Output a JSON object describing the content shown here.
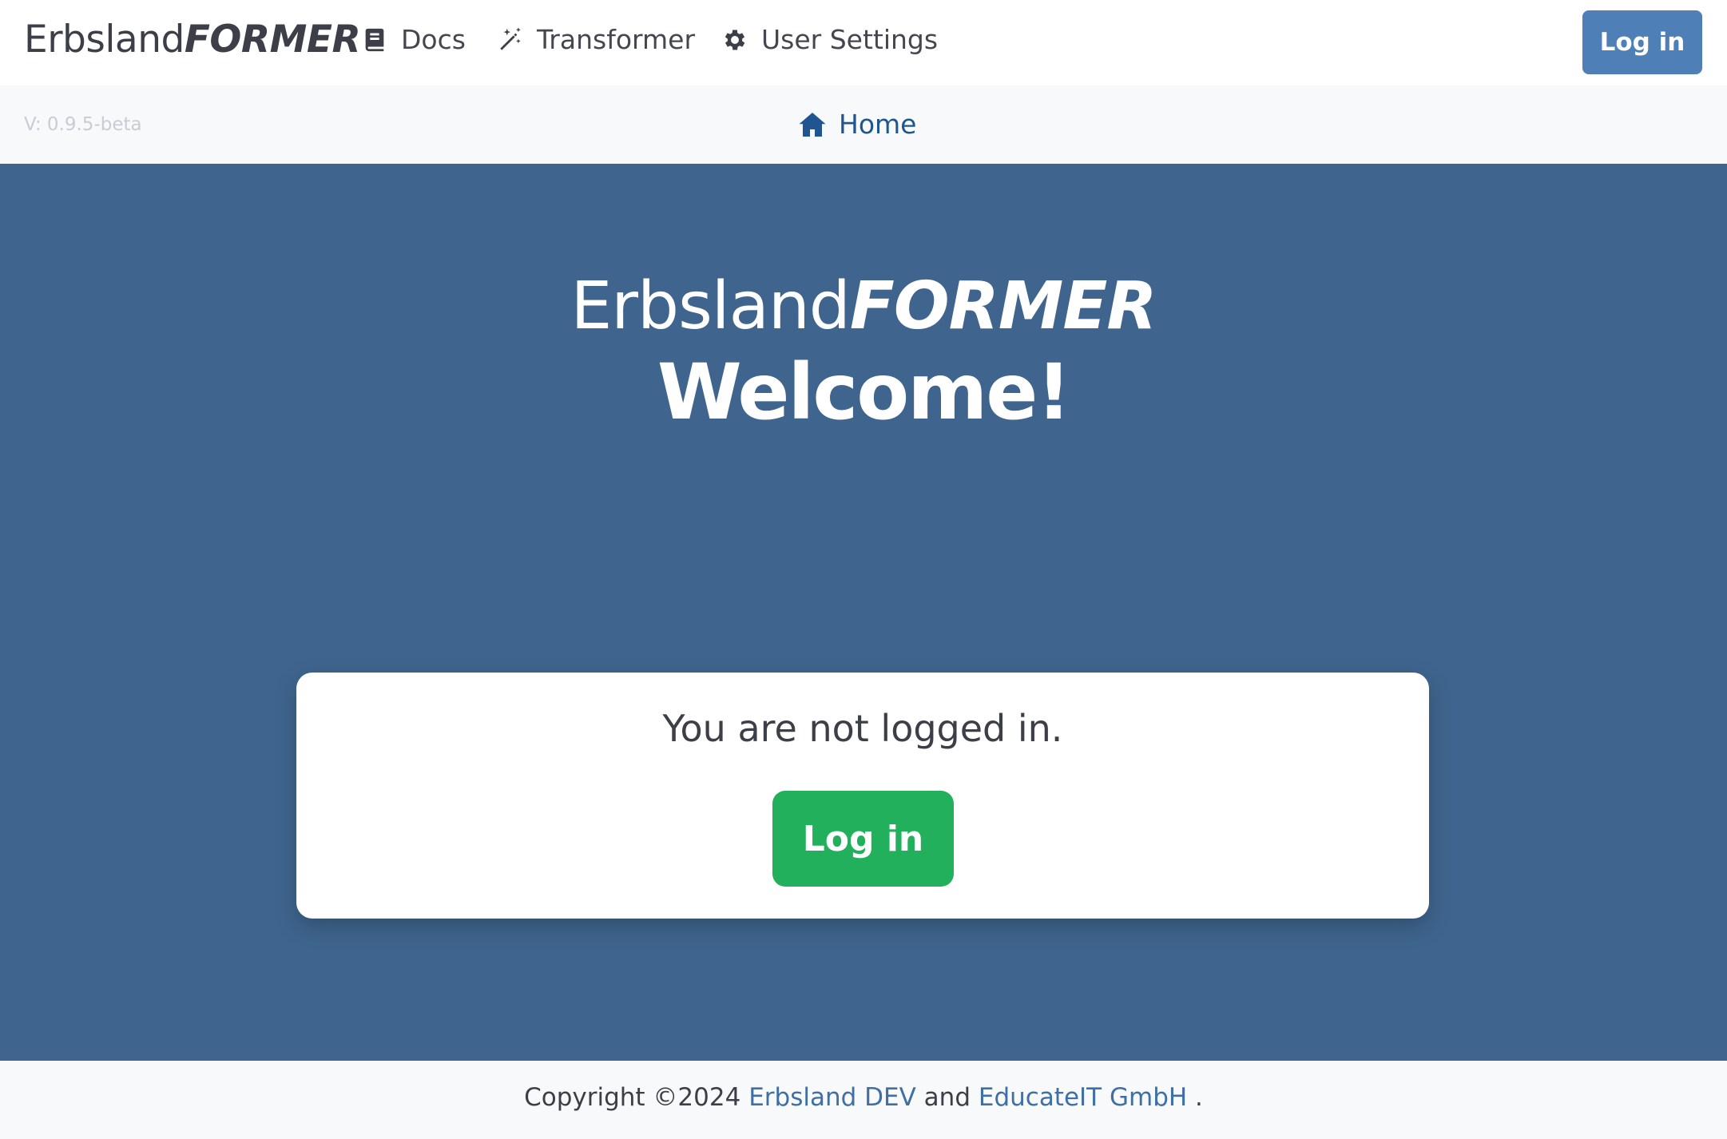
{
  "navbar": {
    "brand_regular": "Erbsland",
    "brand_bold": "FORMER",
    "items": [
      {
        "label": "Docs",
        "icon": "book-icon"
      },
      {
        "label": "Transformer",
        "icon": "magic-wand-icon"
      },
      {
        "label": "User Settings",
        "icon": "gear-icon"
      }
    ],
    "login_label": "Log in"
  },
  "subbar": {
    "version": "V: 0.9.5-beta",
    "home_label": "Home",
    "home_icon": "home-icon"
  },
  "hero": {
    "brand_regular": "Erbsland",
    "brand_bold": "FORMER",
    "welcome": "Welcome!"
  },
  "card": {
    "message": "You are not logged in.",
    "login_label": "Log in"
  },
  "footer": {
    "copyright": "Copyright ©2024",
    "company1": "Erbsland DEV",
    "and": "and",
    "company2": "EducateIT GmbH",
    "period": "."
  },
  "colors": {
    "primary_button": "#4e7fb6",
    "hero_background": "#3f658e",
    "success_button": "#22b05c",
    "link": "#1f5591"
  }
}
